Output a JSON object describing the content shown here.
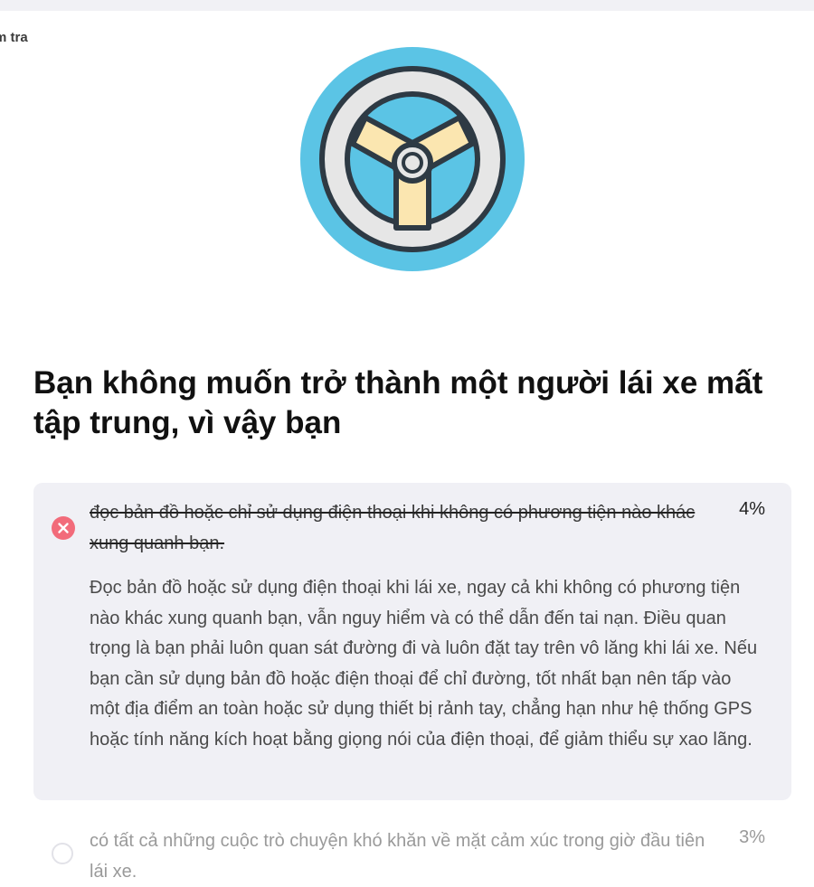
{
  "header": {
    "crumb": "m tra"
  },
  "illustration": {
    "icon": "steering-wheel-icon",
    "colors": {
      "outer": "#5bc4e5",
      "rim_stroke": "#2e3a44",
      "rim_fill": "#e6e6e6",
      "spokes": "#fbe6b0",
      "hub": "#e6e6e6"
    }
  },
  "question": {
    "text": "Bạn không muốn trở thành một người lái xe mất tập trung, vì vậy bạn"
  },
  "answers": [
    {
      "text": "đọc bản đồ hoặc chỉ sử dụng điện thoại khi không có phương tiện nào khác xung quanh bạn.",
      "percent": "4%",
      "status": "wrong",
      "explanation": "Đọc bản đồ hoặc sử dụng điện thoại khi lái xe, ngay cả khi không có phương tiện nào khác xung quanh bạn, vẫn nguy hiểm và có thể dẫn đến tai nạn. Điều quan trọng là bạn phải luôn quan sát đường đi và luôn đặt tay trên vô lăng khi lái xe. Nếu bạn cần sử dụng bản đồ hoặc điện thoại để chỉ đường, tốt nhất bạn nên tấp vào một địa điểm an toàn hoặc sử dụng thiết bị rảnh tay, chẳng hạn như hệ thống GPS hoặc tính năng kích hoạt bằng giọng nói của điện thoại, để giảm thiểu sự xao lãng."
    },
    {
      "text": "có tất cả những cuộc trò chuyện khó khăn về mặt cảm xúc trong giờ đầu tiên lái xe.",
      "percent": "3%",
      "status": "unselected"
    }
  ],
  "colors": {
    "wrong": "#f26b7a",
    "card_bg": "#f0f0f5"
  }
}
